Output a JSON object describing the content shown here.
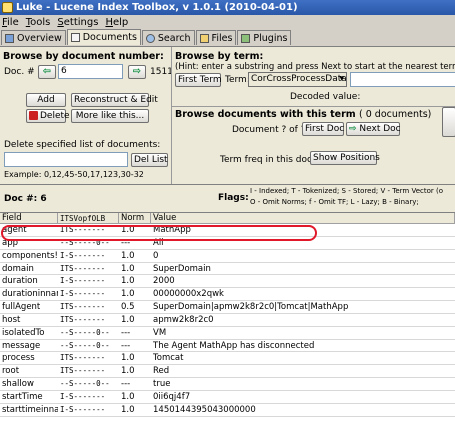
{
  "window": {
    "title": "Luke - Lucene Index Toolbox, v 1.0.1 (2010-04-01)"
  },
  "menu": [
    {
      "mnemonic": "F",
      "rest": "ile"
    },
    {
      "mnemonic": "T",
      "rest": "ools"
    },
    {
      "mnemonic": "S",
      "rest": "ettings"
    },
    {
      "mnemonic": "H",
      "rest": "elp"
    }
  ],
  "tabs": [
    "Overview",
    "Documents",
    "Search",
    "Files",
    "Plugins"
  ],
  "browse_doc": {
    "title": "Browse by document number:",
    "doc_label": "Doc. #",
    "doc_min": "0",
    "doc_value": "6",
    "doc_max": "1511",
    "add": "Add",
    "reconstruct": "Reconstruct & Edit",
    "delete": "Delete",
    "more_like": "More like this...",
    "delete_list_label": "Delete specified list of documents:",
    "delete_list_value": "",
    "del_list_button": "Del List",
    "example": "Example: 0,12,45-50,17,123,30-32"
  },
  "browse_term": {
    "title": "Browse by term:",
    "hint": "(Hint: enter a substring and press Next to start at the nearest term).",
    "first_term": "First Term",
    "term_label": "Term:",
    "term_field": "CorCrossProcessData",
    "decoded_label": "Decoded value:"
  },
  "browse_with_term": {
    "title": "Browse documents with this term",
    "count": "( 0 documents)",
    "doc_of": "Document ? of ?",
    "first_doc": "First Doc",
    "next_doc": "Next Doc",
    "freq_label": "Term freq in this doc: ?",
    "show_positions": "Show Positions"
  },
  "doc_header": {
    "doc_number": "Doc #: 6",
    "flags_label": "Flags:",
    "flags_line1": "I - Indexed;    T - Tokenized;  S - Stored;  V - Term Vector (o",
    "flags_line2": "O - Omit Norms;  f - Omit TF;    L - Lazy;   B - Binary;"
  },
  "table": {
    "columns": [
      "Field",
      "ITSVopfOLB",
      "Norm",
      "Value"
    ],
    "rows": [
      [
        "agent",
        "ITS-------",
        "1.0",
        "MathApp"
      ],
      [
        "app",
        "--S-----0--",
        "---",
        "All"
      ],
      [
        "components!",
        "I-S-------",
        "1.0",
        "0"
      ],
      [
        "domain",
        "ITS-------",
        "1.0",
        "SuperDomain"
      ],
      [
        "duration",
        "I-S-------",
        "1.0",
        "2000"
      ],
      [
        "durationinnar",
        "I-S-------",
        "1.0",
        "00000000x2qwk"
      ],
      [
        "fullAgent",
        "ITS-------",
        "0.5",
        "SuperDomain|apmw2k8r2c0|Tomcat|MathApp"
      ],
      [
        "host",
        "ITS-------",
        "1.0",
        "apmw2k8r2c0"
      ],
      [
        "isolatedTo",
        "--S-----0--",
        "---",
        "VM"
      ],
      [
        "message",
        "--S-----0--",
        "---",
        "The Agent MathApp has disconnected"
      ],
      [
        "process",
        "ITS-------",
        "1.0",
        "Tomcat"
      ],
      [
        "root",
        "ITS-------",
        "1.0",
        "Red"
      ],
      [
        "shallow",
        "--S-----0--",
        "---",
        "true"
      ],
      [
        "startTime",
        "I-S-------",
        "1.0",
        "0ii6qj4f7"
      ],
      [
        "starttimeinna",
        "I-S-------",
        "1.0",
        "1450144395043000000"
      ]
    ]
  },
  "colors": {
    "highlight": "#e0182a",
    "titlebar": "#2a57a8"
  }
}
